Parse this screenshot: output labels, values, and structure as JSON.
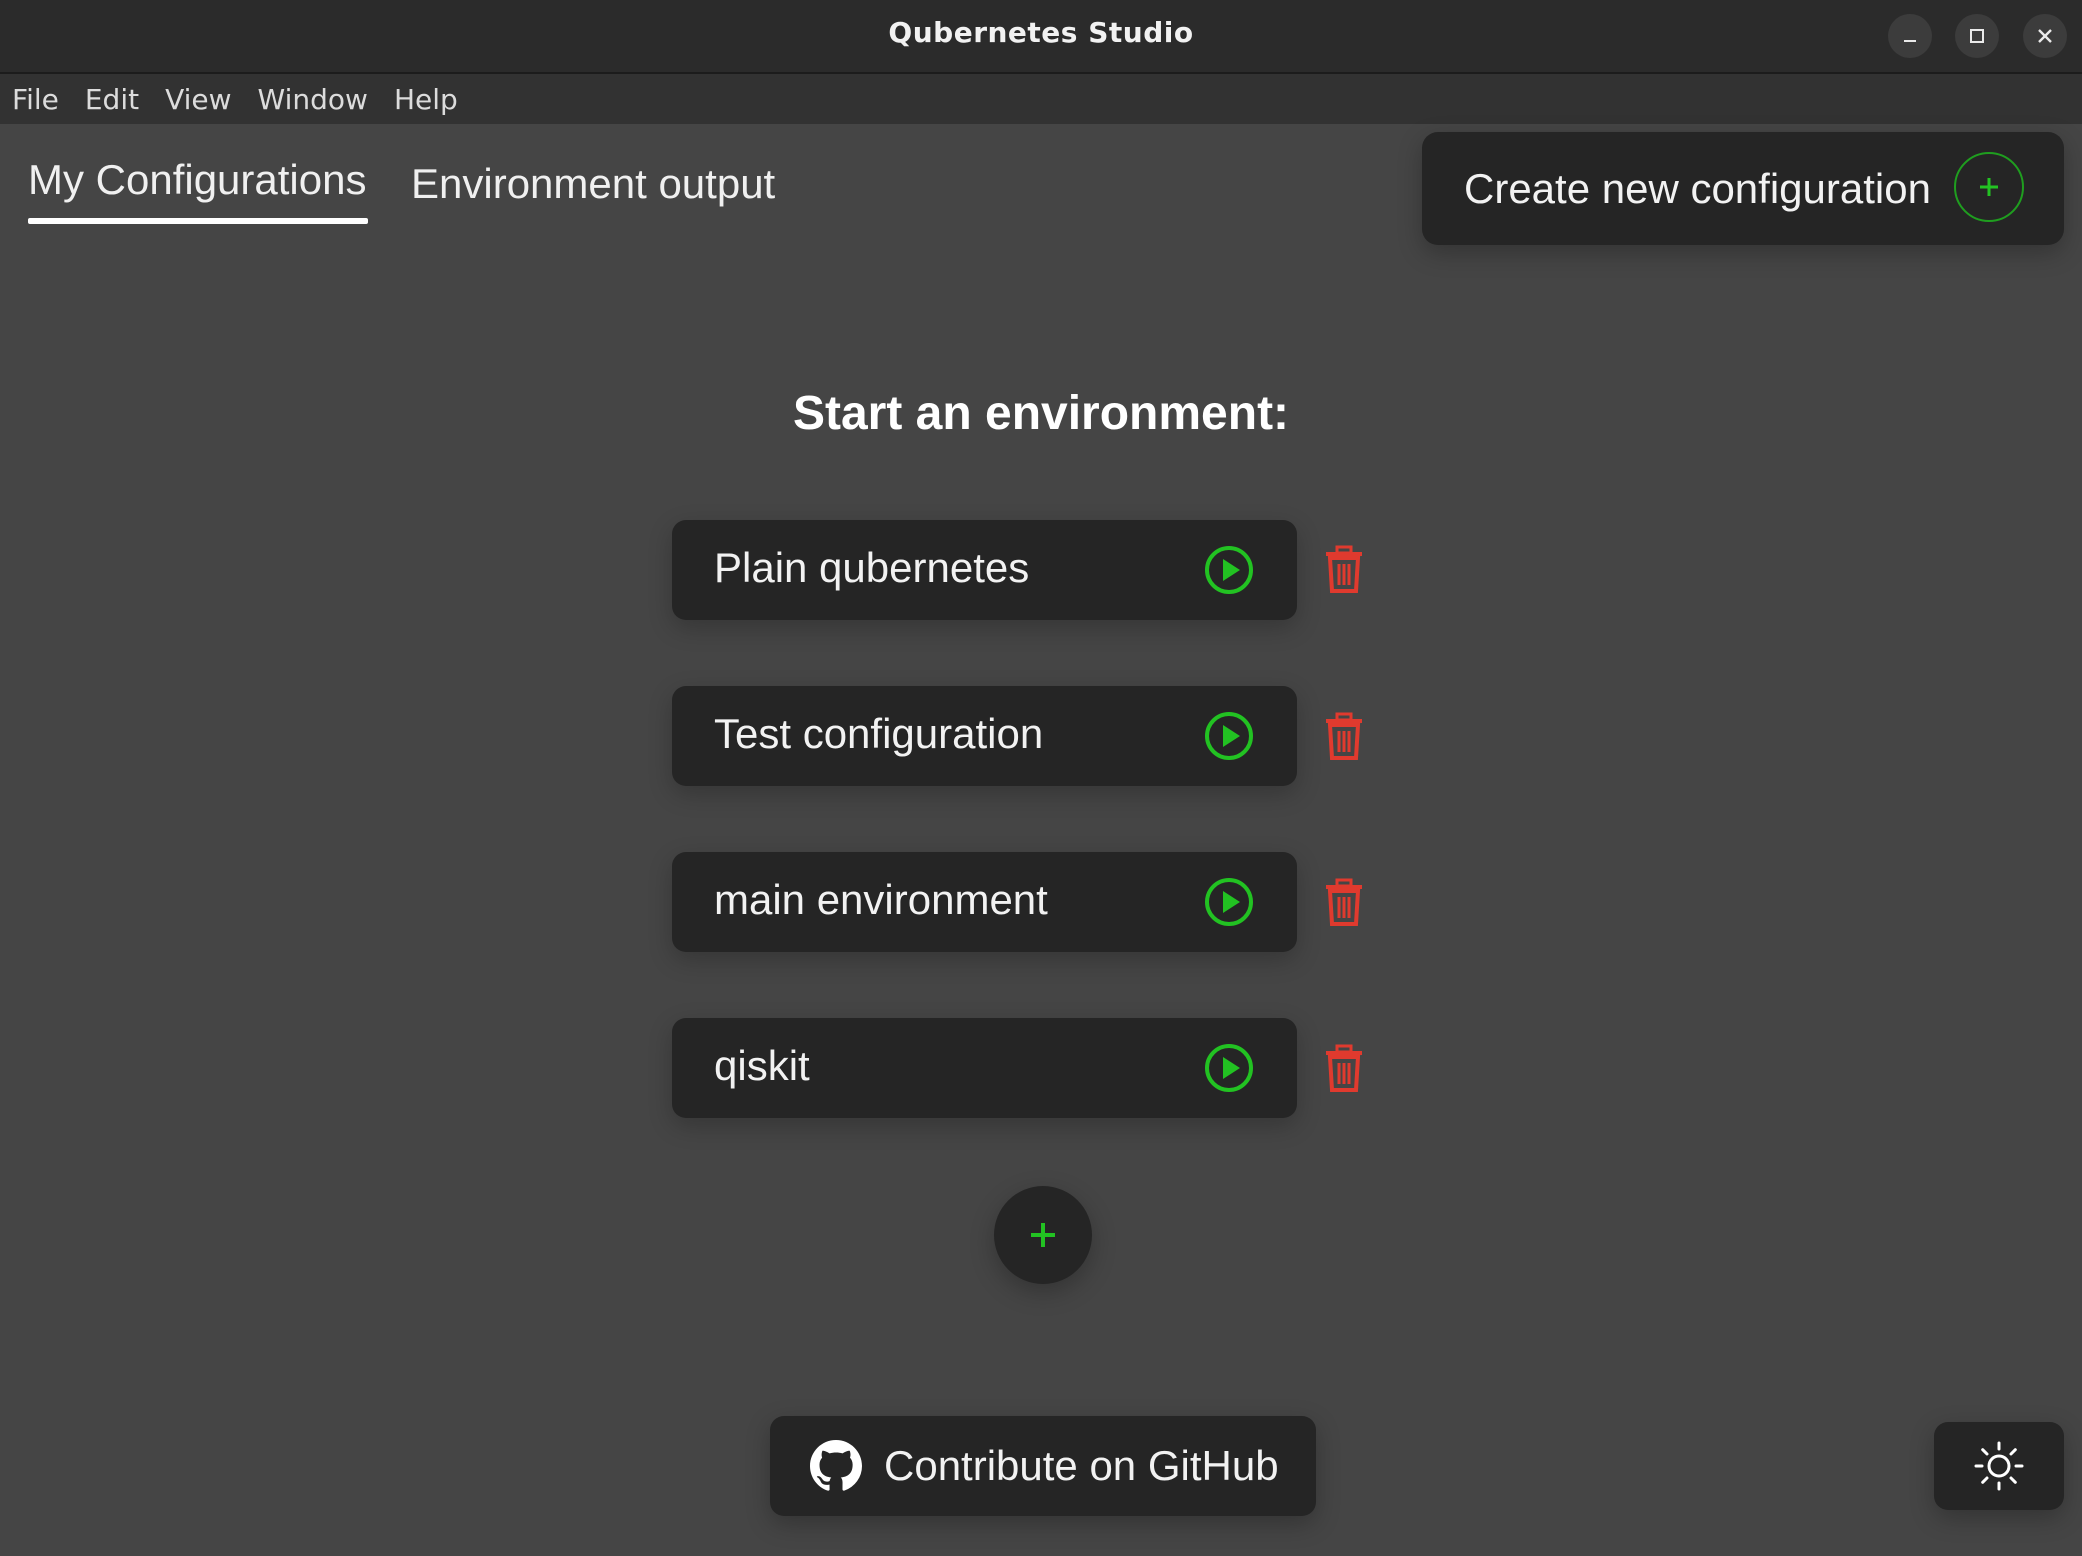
{
  "window": {
    "title": "Qubernetes Studio",
    "controls": [
      "minimize",
      "maximize",
      "close"
    ]
  },
  "menubar": {
    "items": [
      "File",
      "Edit",
      "View",
      "Window",
      "Help"
    ]
  },
  "tabs": [
    {
      "label": "My Configurations",
      "active": true
    },
    {
      "label": "Environment output",
      "active": false
    }
  ],
  "create_button": {
    "label": "Create new configuration",
    "icon": "plus-icon"
  },
  "main": {
    "heading": "Start an environment:",
    "configurations": [
      {
        "name": "Plain qubernetes"
      },
      {
        "name": "Test configuration"
      },
      {
        "name": "main environment"
      },
      {
        "name": "qiskit"
      }
    ],
    "add_button_icon": "plus-icon"
  },
  "footer": {
    "github_label": "Contribute on GitHub",
    "github_icon": "github-icon",
    "theme_icon": "sun-icon"
  },
  "colors": {
    "background": "#454545",
    "card": "#252525",
    "accent_green": "#22c222",
    "delete_red": "#e03a2e",
    "titlebar": "#2b2b2b",
    "menubar": "#323232"
  }
}
